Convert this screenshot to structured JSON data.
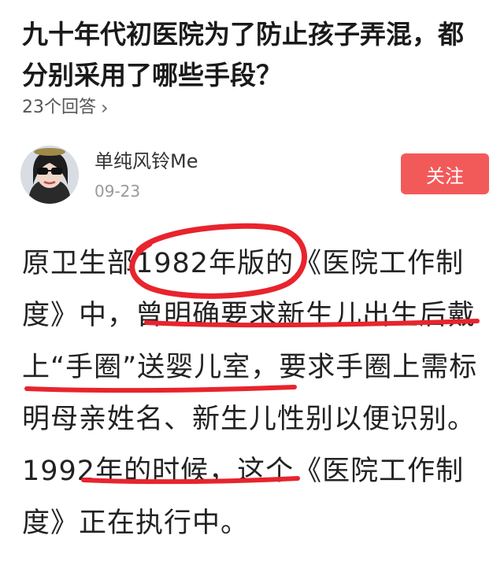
{
  "question": {
    "title": "九十年代初医院为了防止孩子弄混，都分别采用了哪些手段？",
    "answer_count": "23个回答",
    "chevron_icon": "chevron-right-icon"
  },
  "answer": {
    "author": "单纯风铃Me",
    "date": "09-23",
    "follow_label": "关注",
    "follow_color": "#f25a5a",
    "text": "原卫生部1982年版的《医院工作制度》中，曾明确要求新生儿出生后戴上“手圈”送婴儿室，要求手圈上需标明母亲姓名、新生儿性别以便识别。1992年的时候，这个《医院工作制度》正在执行中。"
  },
  "annotations": {
    "color": "#e8242d"
  }
}
